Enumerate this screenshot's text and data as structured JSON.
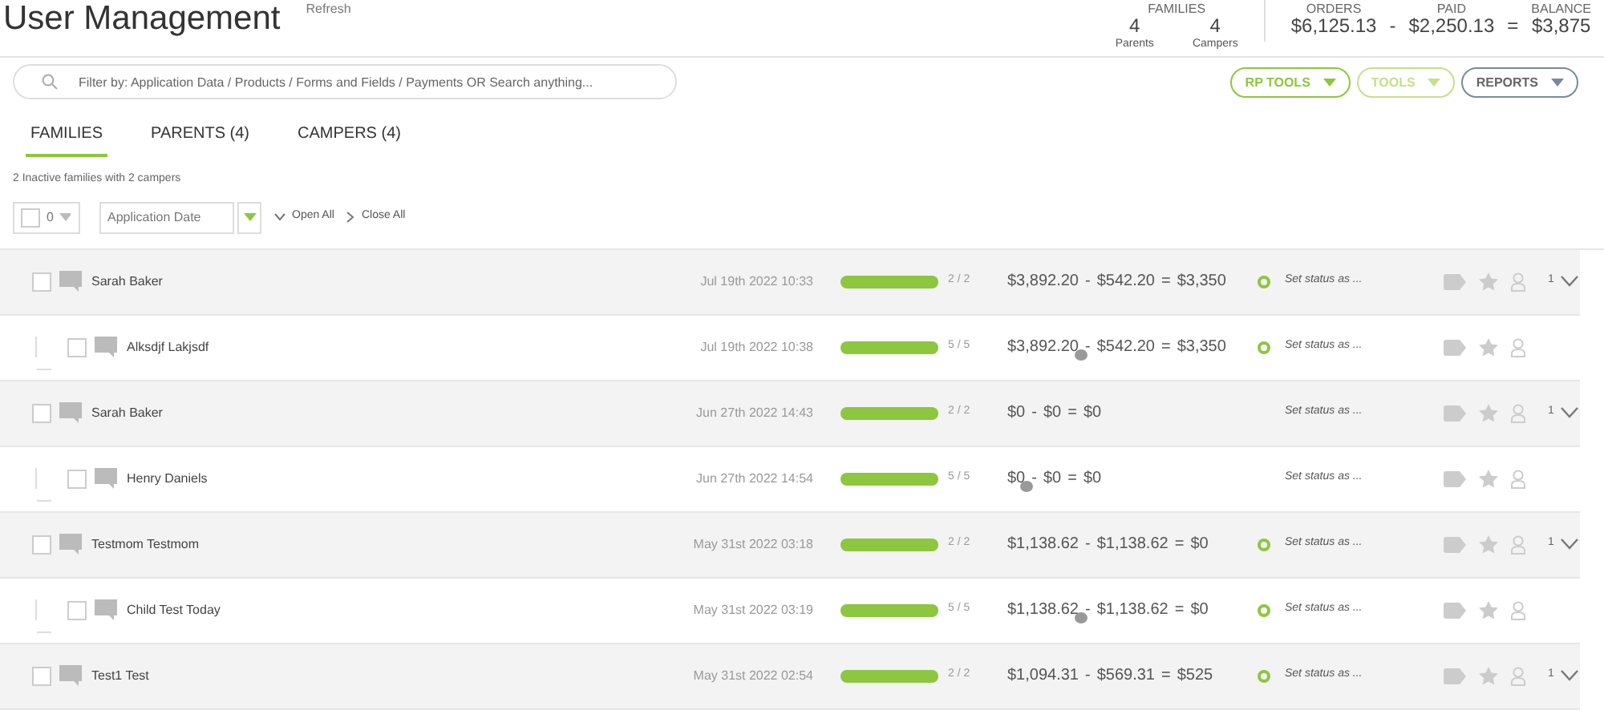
{
  "header": {
    "title": "User Management",
    "refresh": "Refresh",
    "families": {
      "label": "FAMILIES",
      "parents": "4",
      "parents_label": "Parents",
      "campers": "4",
      "campers_label": "Campers"
    },
    "totals": {
      "orders_label": "ORDERS",
      "orders": "$6,125.13",
      "minus": "-",
      "paid_label": "PAID",
      "paid": "$2,250.13",
      "equals": "=",
      "balance_label": "BALANCE",
      "balance": "$3,875"
    }
  },
  "search": {
    "placeholder": "Filter by: Application Data / Products / Forms and Fields / Payments OR Search anything..."
  },
  "tool_buttons": [
    {
      "label": "RP TOOLS",
      "color": "#8dc63f"
    },
    {
      "label": "TOOLS",
      "color": "#c5e08a"
    },
    {
      "label": "REPORTS",
      "color": "#7a8a9a"
    }
  ],
  "tabs": [
    {
      "label": "FAMILIES",
      "selected": true
    },
    {
      "label": "PARENTS (4)",
      "selected": false
    },
    {
      "label": "CAMPERS (4)",
      "selected": false
    }
  ],
  "summary": "2 Inactive families with 2 campers",
  "toolbar": {
    "select_all": {
      "checked": false,
      "count": "0"
    },
    "sort": {
      "value": "Application Date"
    },
    "open_all": "Open All",
    "close_all": "Close All"
  },
  "families": [
    {
      "name": "Sarah Baker",
      "checked": false,
      "date": "Jul 19th 2022 10:33",
      "level": 1,
      "progress": "2 / 2",
      "orders": "$3,892.20",
      "minus": "-",
      "paid": "$542.20",
      "equals": "=",
      "balance": "$3,350",
      "status_dot": true,
      "status": "Set status as ...",
      "children_count": "1",
      "children": [
        {
          "name": "Alksdjf Lakjsdf",
          "checked": false,
          "date": "Jul 19th 2022 10:38",
          "level": 1,
          "progress": "5 / 5",
          "orders": "$3,892.20",
          "minus": "-",
          "paid": "$542.20",
          "equals": "=",
          "balance": "$3,350",
          "status_dot": true,
          "status": "Set status as ..."
        }
      ]
    },
    {
      "name": "Sarah Baker",
      "checked": false,
      "date": "Jun 27th 2022 14:43",
      "level": 1,
      "progress": "2 / 2",
      "orders": "$0",
      "minus": "-",
      "paid": "$0",
      "equals": "=",
      "balance": "$0",
      "status_dot": false,
      "status": "Set status as ...",
      "children_count": "1",
      "children": [
        {
          "name": "Henry Daniels",
          "checked": false,
          "date": "Jun 27th 2022 14:54",
          "level": 1,
          "progress": "5 / 5",
          "orders": "$0",
          "minus": "-",
          "paid": "$0",
          "equals": "=",
          "balance": "$0",
          "status_dot": false,
          "status": "Set status as ..."
        }
      ]
    },
    {
      "name": "Testmom Testmom",
      "checked": false,
      "date": "May 31st 2022 03:18",
      "level": 1,
      "progress": "2 / 2",
      "orders": "$1,138.62",
      "minus": "-",
      "paid": "$1,138.62",
      "equals": "=",
      "balance": "$0",
      "status_dot": true,
      "status": "Set status as ...",
      "children_count": "1",
      "children": [
        {
          "name": "Child Test Today",
          "checked": false,
          "date": "May 31st 2022 03:19",
          "level": 1,
          "progress": "5 / 5",
          "orders": "$1,138.62",
          "minus": "-",
          "paid": "$1,138.62",
          "equals": "=",
          "balance": "$0",
          "status_dot": true,
          "status": "Set status as ..."
        }
      ]
    },
    {
      "name": "Test1 Test",
      "checked": false,
      "date": "May 31st 2022 02:54",
      "level": 1,
      "progress": "2 / 2",
      "orders": "$1,094.31",
      "minus": "-",
      "paid": "$569.31",
      "equals": "=",
      "balance": "$525",
      "status_dot": true,
      "status": "Set status as ...",
      "children_count": "1"
    }
  ]
}
